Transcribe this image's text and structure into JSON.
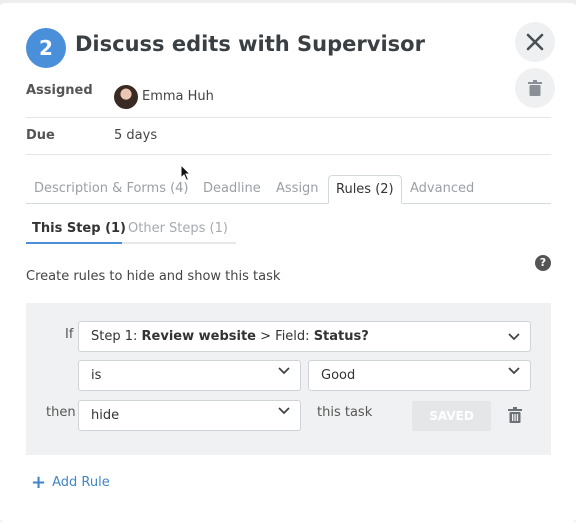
{
  "header": {
    "step_number": "2",
    "title": "Discuss edits with Supervisor"
  },
  "details": {
    "assigned_label": "Assigned",
    "assignee_name": "Emma Huh",
    "due_label": "Due",
    "due_value": "5 days"
  },
  "tabs": [
    {
      "label": "Description & Forms (4)"
    },
    {
      "label": "Deadline"
    },
    {
      "label": "Assign"
    },
    {
      "label": "Rules (2)"
    },
    {
      "label": "Advanced"
    }
  ],
  "subtabs": [
    {
      "label": "This Step (1)"
    },
    {
      "label": "Other Steps (1)"
    }
  ],
  "rules": {
    "description": "Create rules to hide and show this task",
    "help_glyph": "?",
    "if_label": "If",
    "field_step": "Step 1:",
    "field_step_name": "Review website",
    "field_sep": " > Field: ",
    "field_name": "Status?",
    "operator": "is",
    "value": "Good",
    "then_label": "then",
    "action": "hide",
    "target": "this task",
    "saved_label": "SAVED",
    "add_rule_label": "Add Rule"
  },
  "colors": {
    "accent": "#4a8fd9",
    "link": "#3f86c8",
    "rule_bg": "#f0f1f2"
  },
  "icons": {
    "close": "close-icon",
    "trash": "trash-icon",
    "chevron": "chevron-down-icon",
    "help": "question-icon",
    "plus": "plus-icon"
  }
}
